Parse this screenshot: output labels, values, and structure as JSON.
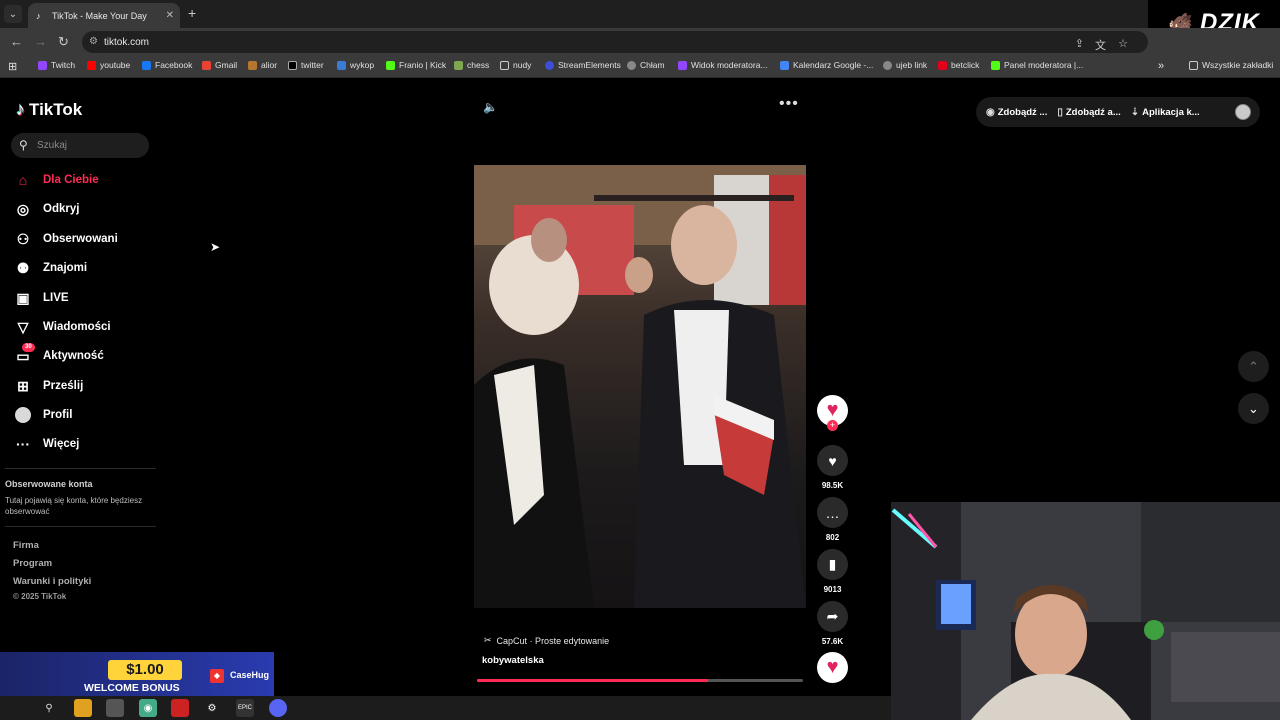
{
  "browser": {
    "tab_title": "TikTok - Make Your Day",
    "url": "tiktok.com",
    "bookmarks": [
      "Twitch",
      "youtube",
      "Facebook",
      "Gmail",
      "alior",
      "twitter",
      "wykop",
      "Franio | Kick",
      "chess",
      "nudy",
      "StreamElements",
      "Chłam",
      "Widok moderatora...",
      "Kalendarz Google -...",
      "ujeb link",
      "betclick",
      "Panel moderatora |..."
    ],
    "all_bookmarks": "Wszystkie zakładki"
  },
  "overlay_brand": "DZIK",
  "tiktok": {
    "logo": "TikTok",
    "search_placeholder": "Szukaj",
    "nav": [
      {
        "label": "Dla Ciebie",
        "icon": "home-icon"
      },
      {
        "label": "Odkryj",
        "icon": "compass-icon"
      },
      {
        "label": "Obserwowani",
        "icon": "user-check-icon"
      },
      {
        "label": "Znajomi",
        "icon": "friends-icon"
      },
      {
        "label": "LIVE",
        "icon": "live-icon"
      },
      {
        "label": "Wiadomości",
        "icon": "messages-icon"
      },
      {
        "label": "Aktywność",
        "icon": "activity-icon",
        "badge": "30"
      },
      {
        "label": "Prześlij",
        "icon": "upload-icon"
      },
      {
        "label": "Profil",
        "icon": "profile-avatar"
      },
      {
        "label": "Więcej",
        "icon": "more-icon"
      }
    ],
    "followed_title": "Obserwowane konta",
    "followed_desc": "Tutaj pojawią się konta, które będziesz obserwować",
    "footer": [
      "Firma",
      "Program",
      "Warunki i polityki"
    ],
    "copyright": "© 2025 TikTok",
    "top_buttons": [
      "Zdobądź ...",
      "Zdobądź a...",
      "Aplikacja k..."
    ],
    "video": {
      "caption_app": "CapCut · Proste edytowanie",
      "username": "kobywatelska",
      "progress": 0.71
    },
    "actions": {
      "likes": "98.5K",
      "comments": "802",
      "saves": "9013",
      "shares": "57.6K"
    }
  },
  "promo": {
    "amount": "$1.00",
    "text": "WELCOME BONUS",
    "brand": "CaseHug"
  },
  "colors": {
    "accent": "#fe2c55",
    "background": "#000000"
  }
}
